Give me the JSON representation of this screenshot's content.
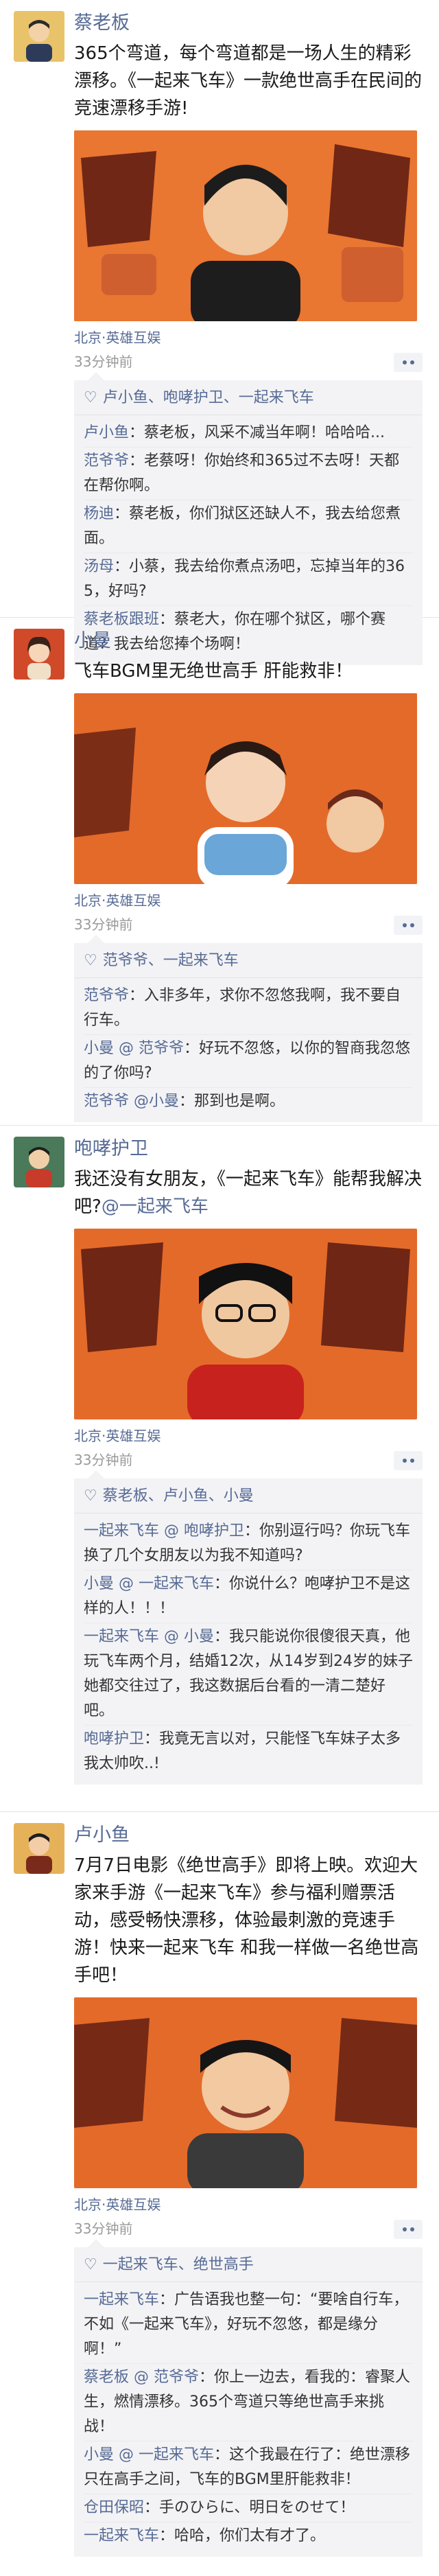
{
  "posts": [
    {
      "author": "蔡老板",
      "text": "365个弯道，每个弯道都是一场人生的精彩漂移。《一起来飞车》一款绝世高手在民间的竞速漂移手游!",
      "location": "北京·英雄互娱",
      "time": "33分钟前",
      "likes": "卢小鱼、咆哮护卫、一起来飞车",
      "comments": [
        {
          "name": "卢小鱼",
          "text": "：蔡老板，风采不减当年啊！哈哈哈..."
        },
        {
          "name": "范爷爷",
          "text": "：老蔡呀！你始终和365过不去呀！天都在帮你啊。"
        },
        {
          "name": "杨迪",
          "text": "：蔡老板，你们狱区还缺人不，我去给您煮面。"
        },
        {
          "name": "汤母",
          "text": "：小蔡，我去给你煮点汤吧，忘掉当年的365，好吗?"
        },
        {
          "name": "蔡老板跟班",
          "text": "：蔡老大，你在哪个狱区，哪个赛道？我去给您捧个场啊！"
        }
      ]
    },
    {
      "author": "小曼",
      "text": "飞车BGM里无绝世高手 肝能救非！",
      "location": "北京·英雄互娱",
      "time": "33分钟前",
      "likes": "范爷爷、一起来飞车",
      "comments": [
        {
          "name": "范爷爷",
          "text": "：入非多年，求你不忽悠我啊，我不要自行车。"
        },
        {
          "name": "小曼 @ 范爷爷",
          "text": "：好玩不忽悠，以你的智商我忽悠的了你吗?"
        },
        {
          "name": "范爷爷 @小曼",
          "text": "：那到也是啊。"
        }
      ]
    },
    {
      "author": "咆哮护卫",
      "text": "我还没有女朋友，《一起来飞车》能帮我解决吧?",
      "at": "@一起来飞车",
      "location": "北京·英雄互娱",
      "time": "33分钟前",
      "likes": "蔡老板、卢小鱼、小曼",
      "comments": [
        {
          "name": "一起来飞车 @ 咆哮护卫",
          "text": "：你别逗行吗？你玩飞车换了几个女朋友以为我不知道吗?"
        },
        {
          "name": "小曼 @ 一起来飞车",
          "text": "：你说什么？咆哮护卫不是这样的人！！！"
        },
        {
          "name": "一起来飞车 @ 小曼",
          "text": "：我只能说你很傻很天真，他玩飞车两个月，结婚12次，从14岁到24岁的妹子她都交往过了，我这数据后台看的一清二楚好吧。"
        },
        {
          "name": "咆哮护卫",
          "text": "：我竟无言以对，只能怪飞车妹子太多我太帅吹..!"
        }
      ]
    },
    {
      "author": "卢小鱼",
      "text": "7月7日电影《绝世高手》即将上映。欢迎大家来手游《一起来飞车》参与福利赠票活动，感受畅快漂移，体验最刺激的竞速手游！快来一起来飞车 和我一样做一名绝世高手吧！",
      "location": "北京·英雄互娱",
      "time": "33分钟前",
      "likes": "一起来飞车、绝世高手",
      "comments": [
        {
          "name": "一起来飞车",
          "text": "：广告语我也整一句：“要啥自行车，不如《一起来飞车》，好玩不忽悠，都是缘分啊！”"
        },
        {
          "name": "蔡老板 @ 范爷爷",
          "text": "：你上一边去，看我的：睿聚人生，燃情漂移。365个弯道只等绝世高手来挑战！"
        },
        {
          "name": "小曼 @ 一起来飞车",
          "text": "：这个我最在行了：绝世漂移 只在高手之间，飞车的BGM里肝能救非！"
        },
        {
          "name": "仓田保昭",
          "text": "：手のひらに、明日をのせて！"
        },
        {
          "name": "一起来飞车",
          "text": "：哈哈，你们太有才了。"
        }
      ]
    }
  ],
  "icons": {
    "heart": "♡"
  },
  "colors": {
    "link": "#576b95",
    "comment_bg": "#f3f3f5",
    "poster_bg": "#e8692c"
  }
}
